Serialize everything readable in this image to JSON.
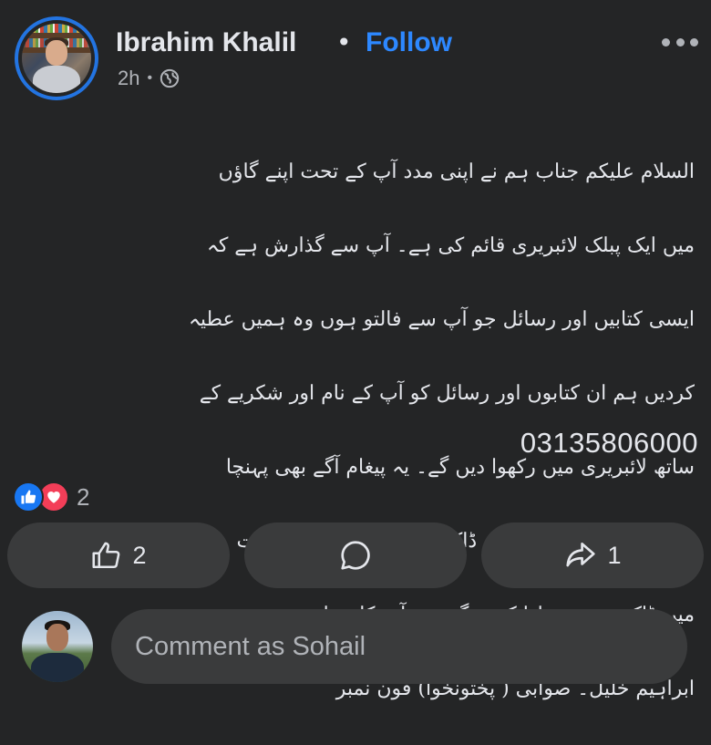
{
  "post": {
    "author": "Ibrahim Khalil",
    "separator": "•",
    "follow_label": "Follow",
    "time": "2h",
    "meta_separator": "•",
    "audience_icon": "globe-icon",
    "more_icon": "more-options-icon",
    "text_lines": [
      "السلام علیکم جناب ہم نے اپنی مدد آپ کے تحت اپنے گاؤں",
      "میں ایک پبلک لائبریری قائم کی ہے۔ آپ سے گذارش ہے کہ",
      "ایسی کتابیں اور رسائل جو آپ سے فالتو ہوں وہ ہمیں عطیہ",
      "کردیں ہم ان کتابوں اور رسائل کو آپ کے نام اور شکریے کے",
      "ساتھ لائبریری میں رکھوا دیں گے۔ یہ پیغام آگے بھی پہنچا",
      "دیں شکریہ۔ نوٹ: بذریعہ ڈاک کتابیں بھیجنے کی صورت",
      "میں ڈاک خرچ ہم ادا کریں گے۔۔۔ آپ کا مخلص محمد",
      "ابراہیم خلیل۔ صوابی ( پختونخوا) فون نمبر"
    ],
    "phone": "03135806000"
  },
  "reactions": {
    "icons": [
      "like-reaction-icon",
      "love-reaction-icon"
    ],
    "count": "2"
  },
  "actions": {
    "like_count": "2",
    "share_count": "1"
  },
  "comment": {
    "placeholder": "Comment as Sohail"
  },
  "colors": {
    "background": "#242526",
    "button": "#3a3b3c",
    "accent": "#2d88ff",
    "like": "#1877f2",
    "love": "#f33e58",
    "text": "#e4e6eb",
    "secondary_text": "#b0b3b8"
  }
}
